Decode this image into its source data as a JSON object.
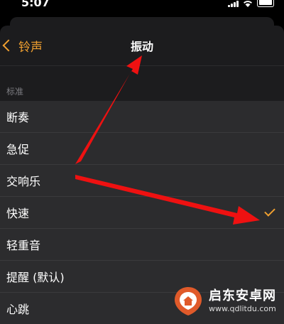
{
  "status_bar": {
    "time": "5:07"
  },
  "nav": {
    "back_label": "铃声",
    "title": "振动"
  },
  "section": {
    "header": "标准",
    "items": [
      {
        "label": "断奏"
      },
      {
        "label": "急促"
      },
      {
        "label": "交响乐"
      },
      {
        "label": "快速",
        "checked": true
      },
      {
        "label": "轻重音"
      },
      {
        "label": "提醒 (默认)"
      },
      {
        "label": "心跳"
      }
    ]
  },
  "watermark": {
    "title": "启东安卓网",
    "url": "www.qdlitdu.com"
  },
  "colors": {
    "accent": "#f0a030",
    "annotation_arrow": "#ee1111",
    "background": "#1c1c1e",
    "row_background": "#2c2c2e"
  }
}
